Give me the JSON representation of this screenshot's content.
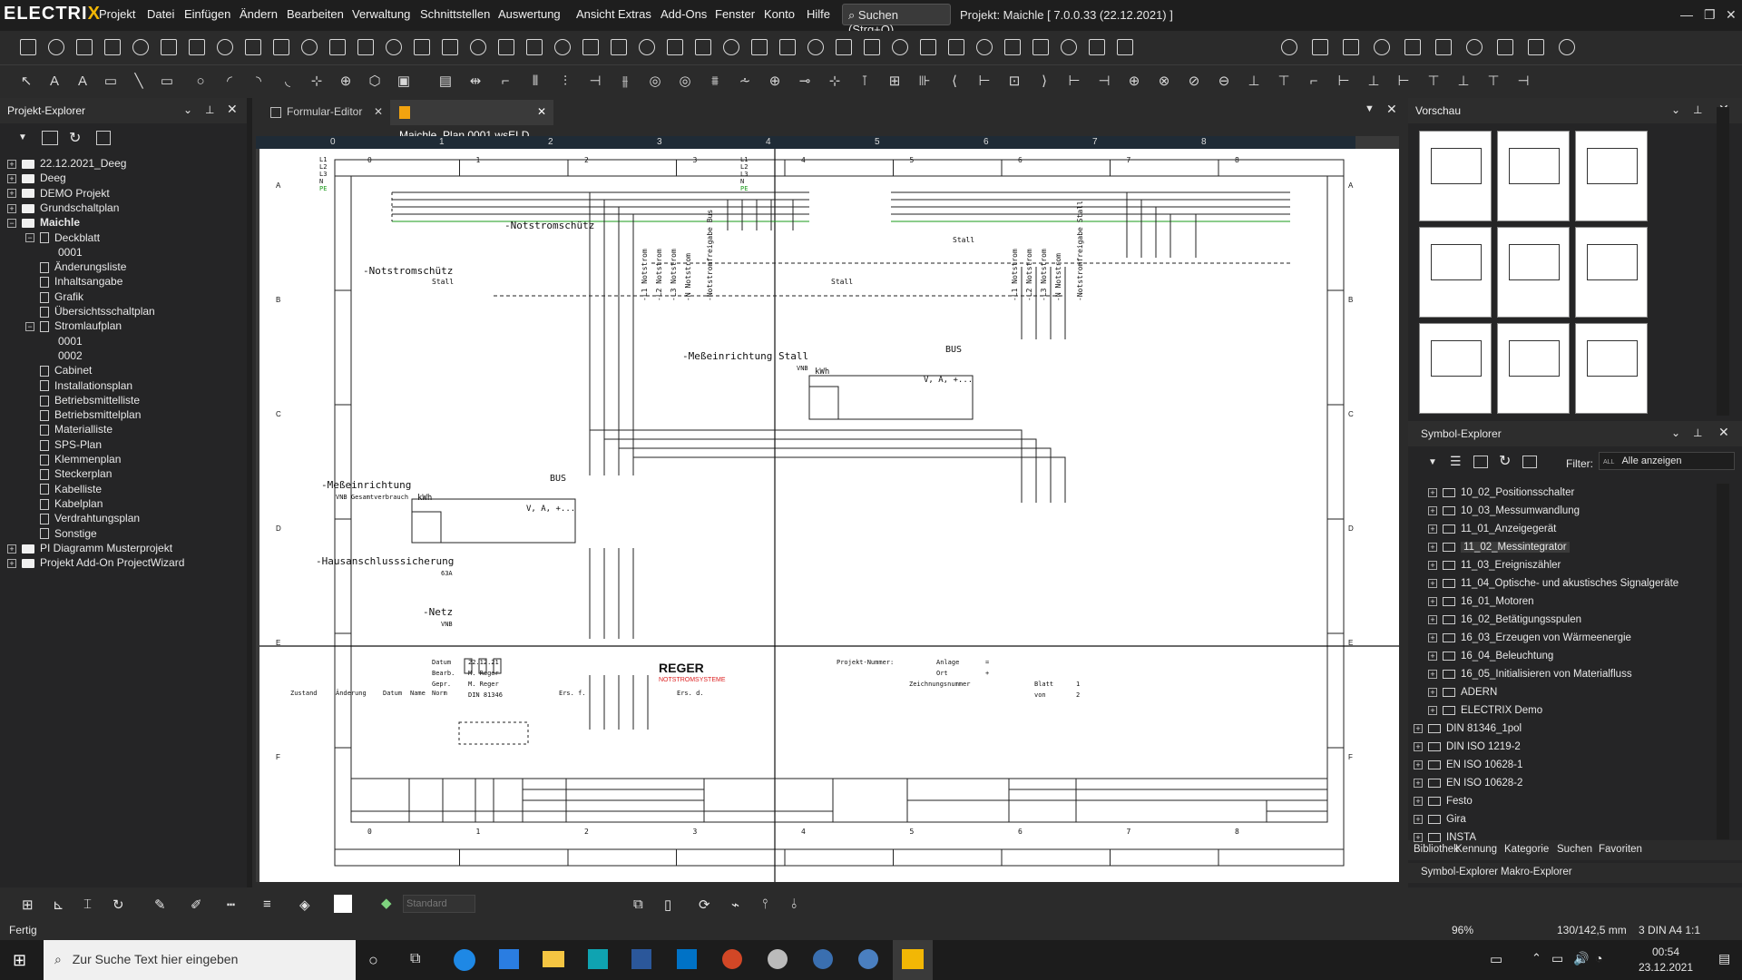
{
  "app": {
    "logo_prefix": "ELECTRI",
    "logo_x": "X"
  },
  "menu": [
    "Projekt",
    "Datei",
    "Einfügen",
    "Ändern",
    "Bearbeiten",
    "Verwaltung",
    "Schnittstellen",
    "Auswertung",
    "Ansicht",
    "Extras",
    "Add-Ons",
    "Fenster",
    "Konto",
    "Hilfe"
  ],
  "search": {
    "label": "Suchen (Strg+Q)"
  },
  "project_title": "Projekt: Maichle  [ 7.0.0.33 (22.12.2021) ]",
  "left_panel": {
    "title": "Projekt-Explorer",
    "items": [
      {
        "label": "22.12.2021_Deeg",
        "level": 0,
        "kind": "folder",
        "exp": "+"
      },
      {
        "label": "Deeg",
        "level": 0,
        "kind": "folder",
        "exp": "+"
      },
      {
        "label": "DEMO Projekt",
        "level": 0,
        "kind": "folder",
        "exp": "+"
      },
      {
        "label": "Grundschaltplan",
        "level": 0,
        "kind": "folder",
        "exp": "+"
      },
      {
        "label": "Maichle",
        "level": 0,
        "kind": "folder",
        "exp": "−"
      },
      {
        "label": "Deckblatt",
        "level": 1,
        "kind": "doc",
        "exp": "−"
      },
      {
        "label": "0001",
        "level": 2,
        "kind": "none",
        "exp": ""
      },
      {
        "label": "Änderungsliste",
        "level": 1,
        "kind": "doc",
        "exp": ""
      },
      {
        "label": "Inhaltsangabe",
        "level": 1,
        "kind": "doc",
        "exp": ""
      },
      {
        "label": "Grafik",
        "level": 1,
        "kind": "doc",
        "exp": ""
      },
      {
        "label": "Übersichtsschaltplan",
        "level": 1,
        "kind": "doc",
        "exp": ""
      },
      {
        "label": "Stromlaufplan",
        "level": 1,
        "kind": "doc",
        "exp": "−"
      },
      {
        "label": "0001",
        "level": 2,
        "kind": "none",
        "exp": ""
      },
      {
        "label": "0002",
        "level": 2,
        "kind": "none",
        "exp": ""
      },
      {
        "label": "Cabinet",
        "level": 1,
        "kind": "doc",
        "exp": ""
      },
      {
        "label": "Installationsplan",
        "level": 1,
        "kind": "doc",
        "exp": ""
      },
      {
        "label": "Betriebsmittelliste",
        "level": 1,
        "kind": "doc",
        "exp": ""
      },
      {
        "label": "Betriebsmittelplan",
        "level": 1,
        "kind": "doc",
        "exp": ""
      },
      {
        "label": "Materialliste",
        "level": 1,
        "kind": "doc",
        "exp": ""
      },
      {
        "label": "SPS-Plan",
        "level": 1,
        "kind": "doc",
        "exp": ""
      },
      {
        "label": "Klemmenplan",
        "level": 1,
        "kind": "doc",
        "exp": ""
      },
      {
        "label": "Steckerplan",
        "level": 1,
        "kind": "doc",
        "exp": ""
      },
      {
        "label": "Kabelliste",
        "level": 1,
        "kind": "doc",
        "exp": ""
      },
      {
        "label": "Kabelplan",
        "level": 1,
        "kind": "doc",
        "exp": ""
      },
      {
        "label": "Verdrahtungsplan",
        "level": 1,
        "kind": "doc",
        "exp": ""
      },
      {
        "label": "Sonstige",
        "level": 1,
        "kind": "doc",
        "exp": ""
      },
      {
        "label": "PI Diagramm Musterprojekt",
        "level": 0,
        "kind": "folder",
        "exp": "+"
      },
      {
        "label": "Projekt Add-On ProjectWizard",
        "level": 0,
        "kind": "folder",
        "exp": "+"
      }
    ]
  },
  "tabs": {
    "t1": "Formular-Editor",
    "t2": "Maichle_Plan.0001.wsELD"
  },
  "ruler": [
    "0",
    "1",
    "2",
    "3",
    "4",
    "5",
    "6",
    "7",
    "8"
  ],
  "rows": [
    "A",
    "B",
    "C",
    "D",
    "E",
    "F"
  ],
  "drawing": {
    "notstrom1": "-Notstromschütz",
    "notstrom2": "-Notstromschütz",
    "stall": "Stall",
    "stall2": "Stall",
    "stall3": "Stall",
    "mess_stall": "-Meßeinrichtung Stall",
    "vnb": "VNB",
    "vnb2": "VNB",
    "mess": "-Meßeinrichtung",
    "mess_sub": "VNB Gesamtverbrauch",
    "haus": "-Hausanschlusssicherung",
    "haus_sub": "63A",
    "netz": "-Netz",
    "bus": "BUS",
    "bus2": "BUS",
    "vat": "V, A, +...",
    "vat2": "V, A, +...",
    "kwh": "kWh",
    "kwh2": "kWh",
    "l1": "L1",
    "l2": "L2",
    "l3": "L3",
    "n": "N",
    "pe": "PE",
    "vlabels": [
      "-L1 Notstrom",
      "-L2 Notstrom",
      "-L3 Notstrom",
      "-N Notstrom",
      "-Notstromfreigabe Bus"
    ],
    "vlabels2": [
      "-L1 Notstrom",
      "-L2 Notstrom",
      "-L3 Notstrom",
      "-N Notstrom",
      "-Notstromfreigabe Stall"
    ]
  },
  "titleblock": {
    "datum_l": "Datum",
    "datum": "22.12.21",
    "bearb_l": "Bearb.",
    "bearb": "M. Reger",
    "gepr_l": "Gepr.",
    "gepr": "M. Reger",
    "name_l": "Name",
    "norm_l": "Norm",
    "norm": "DIN 81346",
    "zustand": "Zustand",
    "aenderung": "Änderung",
    "datum2": "Datum",
    "ers_f": "Ers. f.",
    "ers_d": "Ers. d.",
    "brand": "REGER",
    "brand_sub": "NOTSTROMSYSTEME",
    "projnr": "Projekt-Nummer:",
    "anlage": "Anlage",
    "ort": "Ort",
    "zeichnung": "Zeichnungsnummer",
    "blatt": "Blatt",
    "blatt_v": "1",
    "von": "von",
    "von_v": "2",
    "eq": "=",
    "plus": "+"
  },
  "right_panel": {
    "preview_title": "Vorschau",
    "symbol_title": "Symbol-Explorer",
    "filter_label": "Filter:",
    "filter_value": "Alle anzeigen",
    "filter_badge": "ALL",
    "items": [
      "10_02_Positionsschalter",
      "10_03_Messumwandlung",
      "11_01_Anzeigegerät",
      "11_02_Messintegrator",
      "11_03_Ereigniszähler",
      "11_04_Optische- und akustisches Signalgeräte",
      "16_01_Motoren",
      "16_02_Betätigungsspulen",
      "16_03_Erzeugen von Wärmeenergie",
      "16_04_Beleuchtung",
      "16_05_Initialisieren von Materialfluss",
      "ADERN",
      "ELECTRIX Demo",
      "DIN 81346_1pol",
      "DIN ISO 1219-2",
      "EN ISO 10628-1",
      "EN ISO 10628-2",
      "Festo",
      "Gira",
      "INSTA"
    ],
    "bottom_tabs": [
      "Bibliothek",
      "Kennung",
      "Kategorie",
      "Suchen",
      "Favoriten"
    ],
    "explorer_tabs": [
      "Symbol-Explorer",
      "Makro-Explorer"
    ]
  },
  "layer_combo": "Standard",
  "status": {
    "text": "Fertig",
    "zoom": "96%",
    "coords": "130/142,5 mm",
    "sheet": "3  DIN A4  1:1"
  },
  "taskbar": {
    "search": "Zur Suche Text hier eingeben",
    "time": "00:54",
    "date": "23.12.2021"
  }
}
